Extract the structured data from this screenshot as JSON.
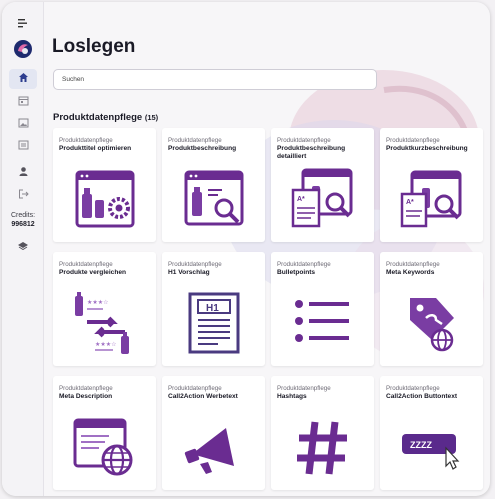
{
  "sidebar": {
    "credits_label": "Credits:",
    "credits_value": "996812",
    "items": [
      {
        "name": "home",
        "active": true
      },
      {
        "name": "calendar"
      },
      {
        "name": "image"
      },
      {
        "name": "document"
      },
      {
        "name": "user"
      },
      {
        "name": "logout"
      }
    ]
  },
  "header": {
    "title": "Loslegen"
  },
  "search": {
    "value": "Suchen"
  },
  "section": {
    "title": "Produktdatenpflege",
    "count": "(15)"
  },
  "cards": [
    {
      "category": "Produktdatenpflege",
      "title": "Produkttitel optimieren",
      "icon": "product-title-icon"
    },
    {
      "category": "Produktdatenpflege",
      "title": "Produktbeschreibung",
      "icon": "product-description-icon"
    },
    {
      "category": "Produktdatenpflege",
      "title": "Produktbeschreibung detailliert",
      "icon": "detailed-description-icon"
    },
    {
      "category": "Produktdatenpflege",
      "title": "Produktkurzbeschreibung",
      "icon": "short-description-icon"
    },
    {
      "category": "Produktdatenpflege",
      "title": "Produkte vergleichen",
      "icon": "compare-icon"
    },
    {
      "category": "Produktdatenpflege",
      "title": "H1 Vorschlag",
      "icon": "h1-icon",
      "icon_text": "H1"
    },
    {
      "category": "Produktdatenpflege",
      "title": "Bulletpoints",
      "icon": "bulletpoints-icon"
    },
    {
      "category": "Produktdatenpflege",
      "title": "Meta Keywords",
      "icon": "keyword-tag-icon"
    },
    {
      "category": "Produktdatenpflege",
      "title": "Meta Description",
      "icon": "meta-description-icon"
    },
    {
      "category": "Produktdatenpflege",
      "title": "Call2Action Werbetext",
      "icon": "megaphone-icon"
    },
    {
      "category": "Produktdatenpflege",
      "title": "Hashtags",
      "icon": "hashtag-icon"
    },
    {
      "category": "Produktdatenpflege",
      "title": "Call2Action Buttontext",
      "icon": "cta-button-icon",
      "icon_text": "ZZZZ"
    }
  ],
  "colors": {
    "accent": "#6a2c91",
    "accent_light": "#a070c4",
    "active_bg": "#e3e6f2"
  }
}
